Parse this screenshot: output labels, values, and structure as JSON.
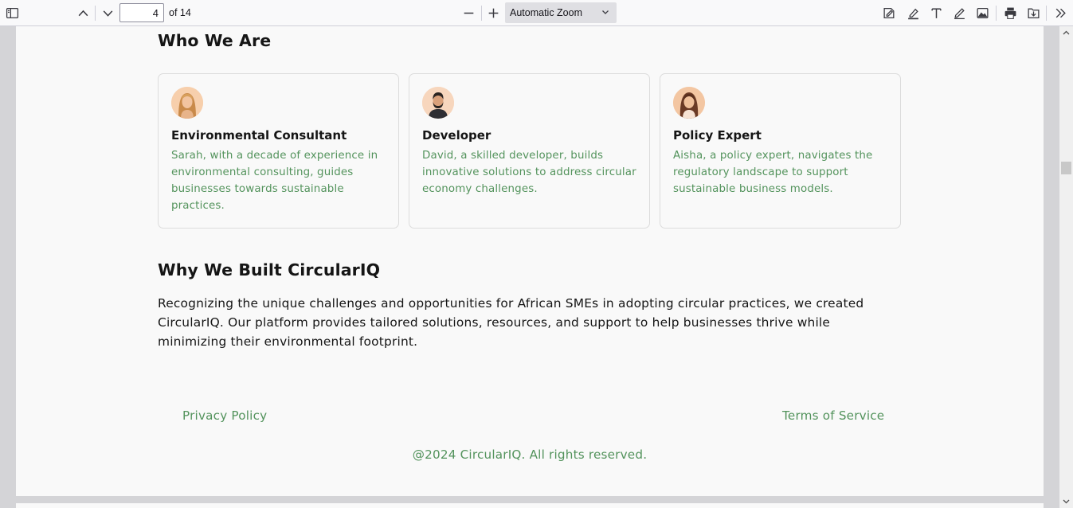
{
  "toolbar": {
    "page_number": "4",
    "page_count": "of 14",
    "zoom": "Automatic Zoom",
    "icons": [
      "sidebar-icon",
      "previous-page-icon",
      "next-page-icon",
      "zoom-out-icon",
      "zoom-in-icon",
      "signature-icon",
      "highlight-icon",
      "text-icon",
      "draw-icon",
      "image-icon",
      "print-icon",
      "save-icon",
      "tools-icon"
    ]
  },
  "document": {
    "who_heading": "Who We Are",
    "team": [
      {
        "title": "Environmental Consultant",
        "description": "Sarah, with a decade of experience in environmental consulting, guides businesses towards sustainable practices."
      },
      {
        "title": "Developer",
        "description": "David, a skilled developer, builds innovative solutions to address circular economy challenges."
      },
      {
        "title": "Policy Expert",
        "description": "Aisha, a policy expert, navigates the regulatory landscape to support sustainable business models."
      }
    ],
    "why_heading": "Why We Built CircularIQ",
    "why_text": "Recognizing the unique challenges and opportunities for African SMEs in adopting circular practices, we created CircularIQ. Our platform provides tailored solutions, resources, and support to help businesses thrive while minimizing their environmental footprint.",
    "footer": {
      "privacy": "Privacy Policy",
      "terms": "Terms of Service",
      "copyright": "@2024 CircularIQ. All rights reserved."
    }
  },
  "colors": {
    "accent_green": "#53935c",
    "heading": "#151515",
    "page_bg": "#f9f9f9"
  }
}
